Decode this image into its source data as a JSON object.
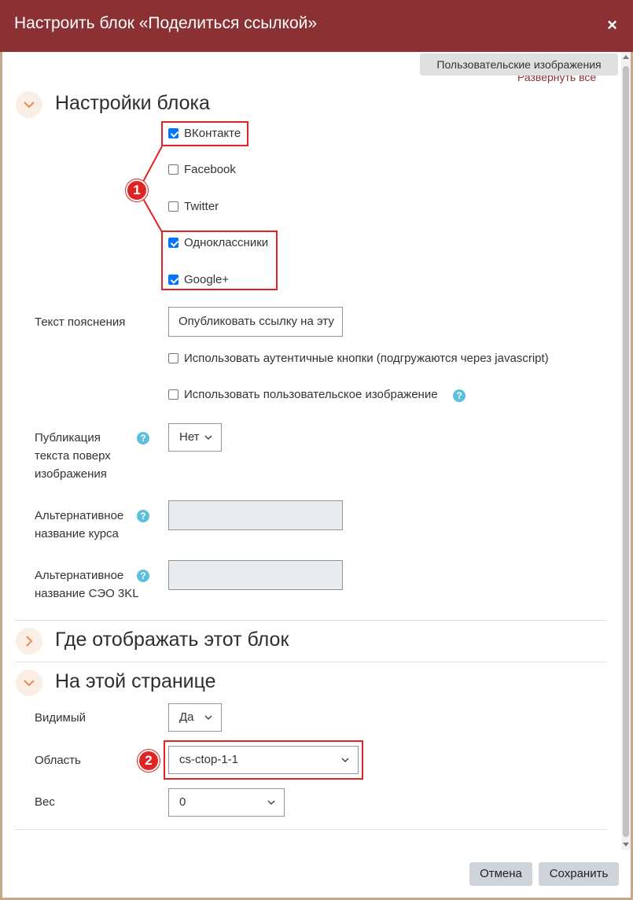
{
  "dialog": {
    "title": "Настроить блок «Поделиться ссылкой»",
    "close": "×",
    "custom_images_button": "Пользовательские изображения",
    "expand_all": "Развернуть все"
  },
  "section_block_settings": {
    "title": "Настройки блока",
    "networks": [
      {
        "label": "ВКонтакте",
        "checked": true
      },
      {
        "label": "Facebook",
        "checked": false
      },
      {
        "label": "Twitter",
        "checked": false
      },
      {
        "label": "Одноклассники",
        "checked": true
      },
      {
        "label": "Google+",
        "checked": true
      }
    ],
    "explain_label": "Текст пояснения",
    "explain_value": "Опубликовать ссылку на эту",
    "authentic_buttons": {
      "label": "Использовать аутентичные кнопки (подгружаются через javascript)",
      "checked": false
    },
    "custom_image": {
      "label": "Использовать пользовательское изображение",
      "checked": false
    },
    "publish_over_image": {
      "label": "Публикация текста поверх изображения",
      "value": "Нет"
    },
    "alt_course_name": {
      "label": "Альтернативное название курса",
      "value": ""
    },
    "alt_seo_name": {
      "label": "Альтернативное название СЭО 3KL",
      "value": ""
    }
  },
  "section_where": {
    "title": "Где отображать этот блок"
  },
  "section_this_page": {
    "title": "На этой странице",
    "visible": {
      "label": "Видимый",
      "value": "Да"
    },
    "region": {
      "label": "Область",
      "value": "cs-ctop-1-1"
    },
    "weight": {
      "label": "Вес",
      "value": "0"
    }
  },
  "annotations": {
    "badge1": "1",
    "badge2": "2"
  },
  "footer": {
    "cancel": "Отмена",
    "save": "Сохранить"
  },
  "colors": {
    "header": "#8b3033",
    "annotation": "#e02424",
    "help": "#5bc0de",
    "checkbox": "#0075ff"
  }
}
